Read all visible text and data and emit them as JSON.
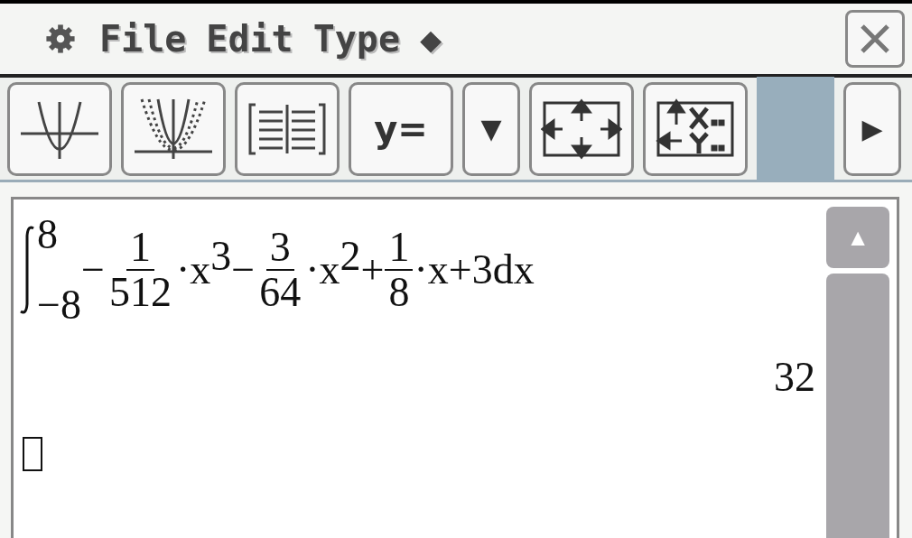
{
  "menu_bar": {
    "items": [
      {
        "kind": "gear"
      },
      {
        "kind": "text",
        "label": "File"
      },
      {
        "kind": "text",
        "label": "Edit"
      },
      {
        "kind": "text",
        "label": "Type"
      },
      {
        "kind": "text",
        "label": "◆"
      }
    ],
    "close": {
      "kind": "close"
    }
  },
  "toolbar": {
    "buttons": [
      {
        "kind": "graph"
      },
      {
        "kind": "multigraph"
      },
      {
        "kind": "table"
      },
      {
        "kind": "text",
        "label": "y="
      },
      {
        "kind": "text",
        "label": "▼"
      },
      {
        "kind": "zoom"
      },
      {
        "kind": "swap"
      },
      {
        "kind": "gap"
      },
      {
        "kind": "text",
        "label": "▶"
      }
    ]
  },
  "work_area": {
    "entries": [
      {
        "kind": "integral",
        "upper": "8",
        "lower": "−8",
        "integrand": [
          {
            "kind": "text",
            "text": "−"
          },
          {
            "kind": "frac",
            "num": "1",
            "den": "512"
          },
          {
            "kind": "text",
            "text": "·x"
          },
          {
            "kind": "sup",
            "text": "3"
          },
          {
            "kind": "text",
            "text": "−"
          },
          {
            "kind": "frac",
            "num": "3",
            "den": "64"
          },
          {
            "kind": "text",
            "text": "·x"
          },
          {
            "kind": "sup",
            "text": "2"
          },
          {
            "kind": "text",
            "text": "+"
          },
          {
            "kind": "frac",
            "num": "1",
            "den": "8"
          },
          {
            "kind": "text",
            "text": "·x+3dx"
          }
        ]
      },
      {
        "kind": "result",
        "text": "32"
      },
      {
        "kind": "cursor"
      }
    ],
    "scroll_up": "▲"
  }
}
